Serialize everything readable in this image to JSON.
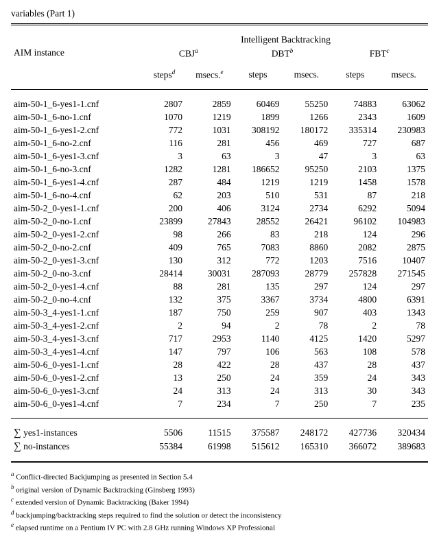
{
  "caption": "variables (Part 1)",
  "header": {
    "col_instance": "AIM instance",
    "group_top": "Intelligent Backtracking",
    "group_cbj": "CBJ",
    "group_dbt": "DBT",
    "group_fbt": "FBT",
    "fn_a": "a",
    "fn_b": "b",
    "fn_c": "c",
    "fn_d": "d",
    "fn_e": "e",
    "sub_steps": "steps",
    "sub_msecs": "msecs."
  },
  "chart_data": {
    "type": "table",
    "columns": [
      "AIM instance",
      "CBJ steps",
      "CBJ msecs.",
      "DBT steps",
      "DBT msecs.",
      "FBT steps",
      "FBT msecs."
    ],
    "rows": [
      {
        "name": "aim-50-1_6-yes1-1.cnf",
        "cbj_s": "2807",
        "cbj_m": "2859",
        "dbt_s": "60469",
        "dbt_m": "55250",
        "fbt_s": "74883",
        "fbt_m": "63062"
      },
      {
        "name": "aim-50-1_6-no-1.cnf",
        "cbj_s": "1070",
        "cbj_m": "1219",
        "dbt_s": "1899",
        "dbt_m": "1266",
        "fbt_s": "2343",
        "fbt_m": "1609"
      },
      {
        "name": "aim-50-1_6-yes1-2.cnf",
        "cbj_s": "772",
        "cbj_m": "1031",
        "dbt_s": "308192",
        "dbt_m": "180172",
        "fbt_s": "335314",
        "fbt_m": "230983"
      },
      {
        "name": "aim-50-1_6-no-2.cnf",
        "cbj_s": "116",
        "cbj_m": "281",
        "dbt_s": "456",
        "dbt_m": "469",
        "fbt_s": "727",
        "fbt_m": "687"
      },
      {
        "name": "aim-50-1_6-yes1-3.cnf",
        "cbj_s": "3",
        "cbj_m": "63",
        "dbt_s": "3",
        "dbt_m": "47",
        "fbt_s": "3",
        "fbt_m": "63"
      },
      {
        "name": "aim-50-1_6-no-3.cnf",
        "cbj_s": "1282",
        "cbj_m": "1281",
        "dbt_s": "186652",
        "dbt_m": "95250",
        "fbt_s": "2103",
        "fbt_m": "1375"
      },
      {
        "name": "aim-50-1_6-yes1-4.cnf",
        "cbj_s": "287",
        "cbj_m": "484",
        "dbt_s": "1219",
        "dbt_m": "1219",
        "fbt_s": "1458",
        "fbt_m": "1578"
      },
      {
        "name": "aim-50-1_6-no-4.cnf",
        "cbj_s": "62",
        "cbj_m": "203",
        "dbt_s": "510",
        "dbt_m": "531",
        "fbt_s": "87",
        "fbt_m": "218"
      },
      {
        "name": "aim-50-2_0-yes1-1.cnf",
        "cbj_s": "200",
        "cbj_m": "406",
        "dbt_s": "3124",
        "dbt_m": "2734",
        "fbt_s": "6292",
        "fbt_m": "5094"
      },
      {
        "name": "aim-50-2_0-no-1.cnf",
        "cbj_s": "23899",
        "cbj_m": "27843",
        "dbt_s": "28552",
        "dbt_m": "26421",
        "fbt_s": "96102",
        "fbt_m": "104983"
      },
      {
        "name": "aim-50-2_0-yes1-2.cnf",
        "cbj_s": "98",
        "cbj_m": "266",
        "dbt_s": "83",
        "dbt_m": "218",
        "fbt_s": "124",
        "fbt_m": "296"
      },
      {
        "name": "aim-50-2_0-no-2.cnf",
        "cbj_s": "409",
        "cbj_m": "765",
        "dbt_s": "7083",
        "dbt_m": "8860",
        "fbt_s": "2082",
        "fbt_m": "2875"
      },
      {
        "name": "aim-50-2_0-yes1-3.cnf",
        "cbj_s": "130",
        "cbj_m": "312",
        "dbt_s": "772",
        "dbt_m": "1203",
        "fbt_s": "7516",
        "fbt_m": "10407"
      },
      {
        "name": "aim-50-2_0-no-3.cnf",
        "cbj_s": "28414",
        "cbj_m": "30031",
        "dbt_s": "287093",
        "dbt_m": "28779",
        "fbt_s": "257828",
        "fbt_m": "271545"
      },
      {
        "name": "aim-50-2_0-yes1-4.cnf",
        "cbj_s": "88",
        "cbj_m": "281",
        "dbt_s": "135",
        "dbt_m": "297",
        "fbt_s": "124",
        "fbt_m": "297"
      },
      {
        "name": "aim-50-2_0-no-4.cnf",
        "cbj_s": "132",
        "cbj_m": "375",
        "dbt_s": "3367",
        "dbt_m": "3734",
        "fbt_s": "4800",
        "fbt_m": "6391"
      },
      {
        "name": "aim-50-3_4-yes1-1.cnf",
        "cbj_s": "187",
        "cbj_m": "750",
        "dbt_s": "259",
        "dbt_m": "907",
        "fbt_s": "403",
        "fbt_m": "1343"
      },
      {
        "name": "aim-50-3_4-yes1-2.cnf",
        "cbj_s": "2",
        "cbj_m": "94",
        "dbt_s": "2",
        "dbt_m": "78",
        "fbt_s": "2",
        "fbt_m": "78"
      },
      {
        "name": "aim-50-3_4-yes1-3.cnf",
        "cbj_s": "717",
        "cbj_m": "2953",
        "dbt_s": "1140",
        "dbt_m": "4125",
        "fbt_s": "1420",
        "fbt_m": "5297"
      },
      {
        "name": "aim-50-3_4-yes1-4.cnf",
        "cbj_s": "147",
        "cbj_m": "797",
        "dbt_s": "106",
        "dbt_m": "563",
        "fbt_s": "108",
        "fbt_m": "578"
      },
      {
        "name": "aim-50-6_0-yes1-1.cnf",
        "cbj_s": "28",
        "cbj_m": "422",
        "dbt_s": "28",
        "dbt_m": "437",
        "fbt_s": "28",
        "fbt_m": "437"
      },
      {
        "name": "aim-50-6_0-yes1-2.cnf",
        "cbj_s": "13",
        "cbj_m": "250",
        "dbt_s": "24",
        "dbt_m": "359",
        "fbt_s": "24",
        "fbt_m": "343"
      },
      {
        "name": "aim-50-6_0-yes1-3.cnf",
        "cbj_s": "24",
        "cbj_m": "313",
        "dbt_s": "24",
        "dbt_m": "313",
        "fbt_s": "30",
        "fbt_m": "343"
      },
      {
        "name": "aim-50-6_0-yes1-4.cnf",
        "cbj_s": "7",
        "cbj_m": "234",
        "dbt_s": "7",
        "dbt_m": "250",
        "fbt_s": "7",
        "fbt_m": "235"
      }
    ],
    "sums": [
      {
        "label": "yes1-instances",
        "cbj_s": "5506",
        "cbj_m": "11515",
        "dbt_s": "375587",
        "dbt_m": "248172",
        "fbt_s": "427736",
        "fbt_m": "320434"
      },
      {
        "label": "no-instances",
        "cbj_s": "55384",
        "cbj_m": "61998",
        "dbt_s": "515612",
        "dbt_m": "165310",
        "fbt_s": "366072",
        "fbt_m": "389683"
      }
    ]
  },
  "footnotes": {
    "a": "Conflict-directed Backjumping as presented in Section 5.4",
    "b": "original version of Dynamic Backtracking (Ginsberg 1993)",
    "c": "extended version of Dynamic Backtracking (Baker 1994)",
    "d": "backjumping/backtracking steps required to find the solution or detect the inconsistency",
    "e": "elapsed runtime on a Pentium IV PC with 2.8 GHz running Windows XP Professional"
  },
  "sigma": "∑"
}
